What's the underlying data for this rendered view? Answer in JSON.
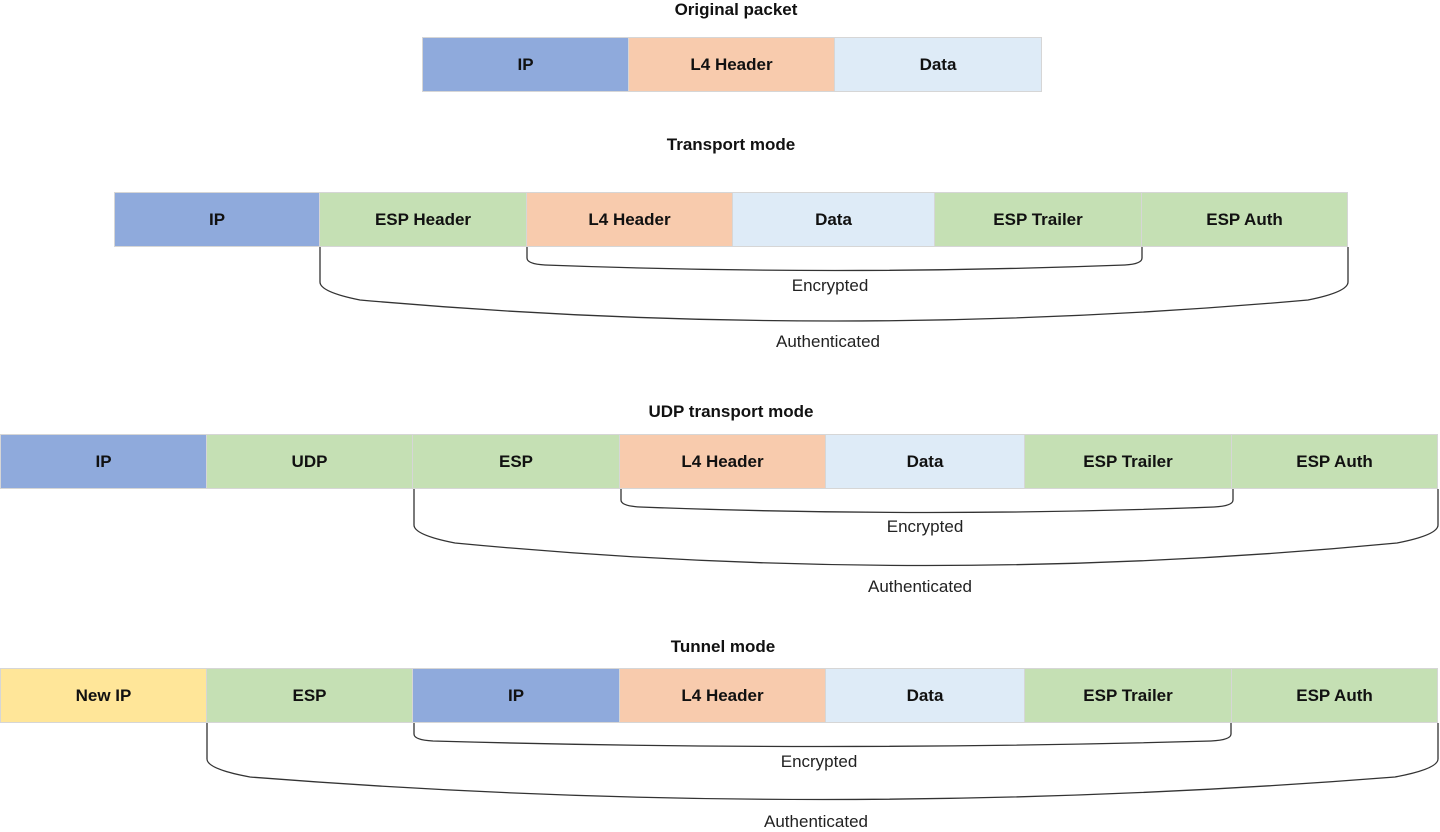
{
  "colors": {
    "ip": "#8faadc",
    "l4": "#f8cbad",
    "data": "#deebf7",
    "esp": "#c5e0b4",
    "new_ip": "#ffe699"
  },
  "sections": [
    {
      "id": "original",
      "title": "Original packet",
      "fields": [
        {
          "label": "IP",
          "kind": "ip"
        },
        {
          "label": "L4 Header",
          "kind": "l4"
        },
        {
          "label": "Data",
          "kind": "data"
        }
      ],
      "brackets": []
    },
    {
      "id": "transport",
      "title": "Transport mode",
      "fields": [
        {
          "label": "IP",
          "kind": "ip"
        },
        {
          "label": "ESP Header",
          "kind": "esp"
        },
        {
          "label": "L4 Header",
          "kind": "l4"
        },
        {
          "label": "Data",
          "kind": "data"
        },
        {
          "label": "ESP Trailer",
          "kind": "esp"
        },
        {
          "label": "ESP Auth",
          "kind": "esp"
        }
      ],
      "brackets": [
        {
          "label": "Encrypted",
          "from_field": 2,
          "to_field": 4
        },
        {
          "label": "Authenticated",
          "from_field": 1,
          "to_field": 5
        }
      ]
    },
    {
      "id": "udp",
      "title": "UDP transport mode",
      "fields": [
        {
          "label": "IP",
          "kind": "ip"
        },
        {
          "label": "UDP",
          "kind": "esp"
        },
        {
          "label": "ESP",
          "kind": "esp"
        },
        {
          "label": "L4 Header",
          "kind": "l4"
        },
        {
          "label": "Data",
          "kind": "data"
        },
        {
          "label": "ESP Trailer",
          "kind": "esp"
        },
        {
          "label": "ESP Auth",
          "kind": "esp"
        }
      ],
      "brackets": [
        {
          "label": "Encrypted",
          "from_field": 3,
          "to_field": 5
        },
        {
          "label": "Authenticated",
          "from_field": 2,
          "to_field": 6
        }
      ]
    },
    {
      "id": "tunnel",
      "title": "Tunnel mode",
      "fields": [
        {
          "label": "New IP",
          "kind": "new_ip"
        },
        {
          "label": "ESP",
          "kind": "esp"
        },
        {
          "label": "IP",
          "kind": "ip"
        },
        {
          "label": "L4 Header",
          "kind": "l4"
        },
        {
          "label": "Data",
          "kind": "data"
        },
        {
          "label": "ESP Trailer",
          "kind": "esp"
        },
        {
          "label": "ESP Auth",
          "kind": "esp"
        }
      ],
      "brackets": [
        {
          "label": "Encrypted",
          "from_field": 2,
          "to_field": 5
        },
        {
          "label": "Authenticated",
          "from_field": 1,
          "to_field": 6
        }
      ]
    }
  ]
}
